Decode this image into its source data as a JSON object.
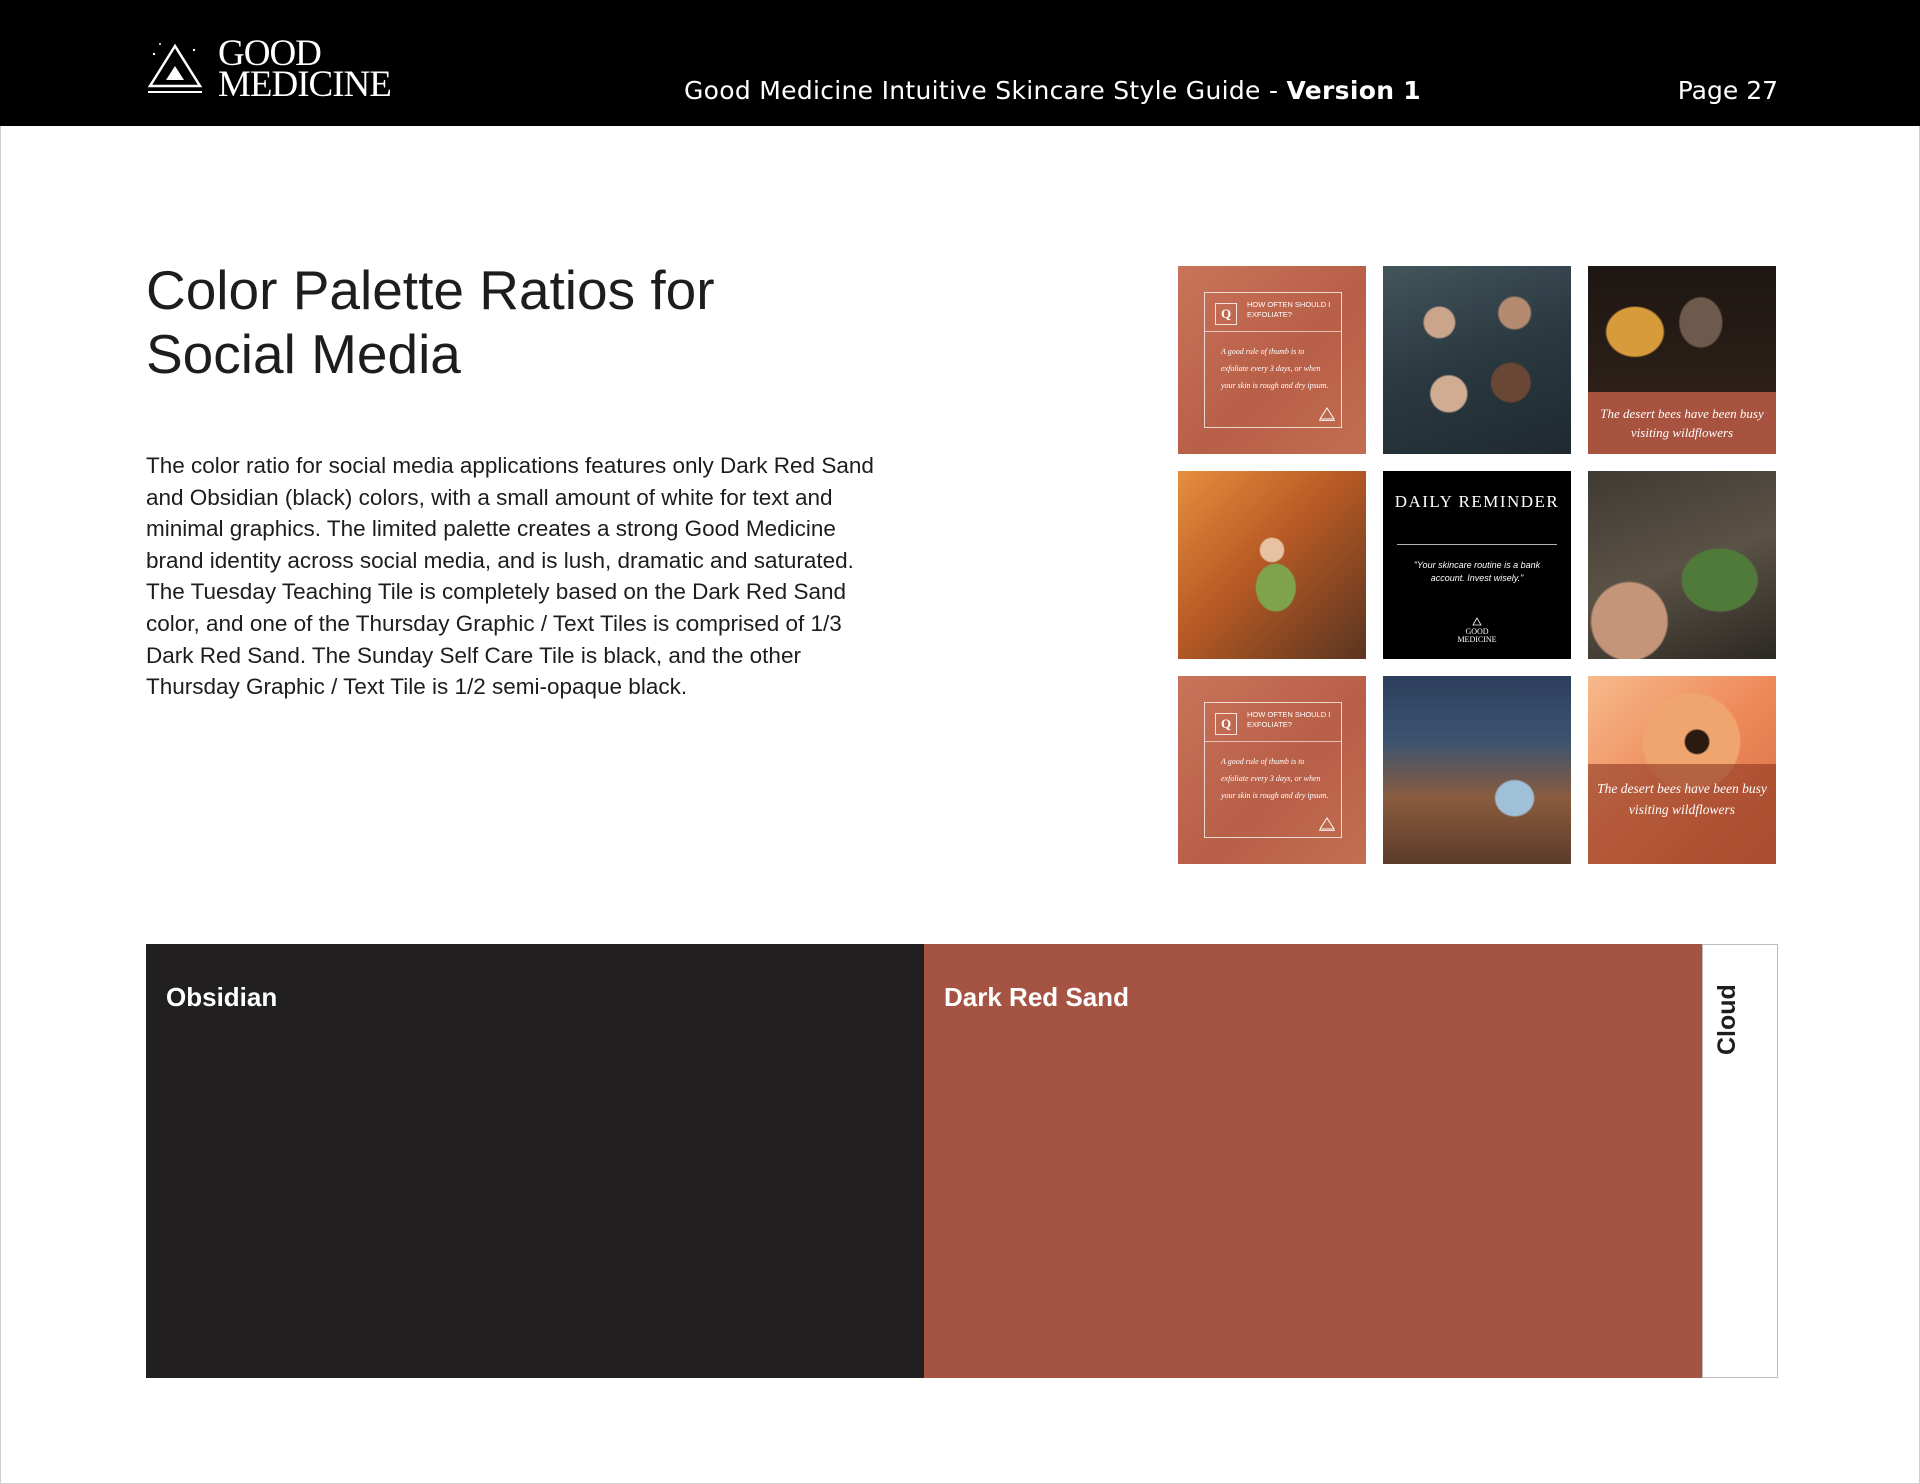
{
  "header": {
    "logo_line1": "GOOD",
    "logo_line2": "MEDICINE",
    "doc_title": "Good Medicine Intuitive Skincare Style Guide - ",
    "doc_version": "Version 1",
    "page_label": "Page 27"
  },
  "main": {
    "heading": "Color Palette Ratios for Social Media",
    "body": "The color ratio for social media applications features only Dark Red Sand and Obsidian (black) colors, with a small amount of white for text and minimal graphics. The limited palette creates a strong Good Medicine brand identity across social media, and is lush, dramatic and saturated. The Tuesday Teaching Tile is completely based on the Dark Red Sand color, and one of the Thursday Graphic / Text Tiles is comprised of 1/3 Dark Red Sand. The Sunday Self Care Tile is black, and the other Thursday Graphic / Text Tile is 1/2 semi-opaque black."
  },
  "tiles": {
    "teaching_q": "Q",
    "teaching_question": "HOW OFTEN SHOULD I EXFOLIATE?",
    "teaching_answer": "A good rule of thumb is to exfoliate every 3 days, or when your skin is rough and dry ipsum.",
    "bees_caption": "The desert bees have been busy visiting wildflowers",
    "reminder_title": "DAILY REMINDER",
    "reminder_quote": "\"Your skincare routine is a bank account. Invest wisely.\"",
    "reminder_logo1": "GOOD",
    "reminder_logo2": "MEDICINE"
  },
  "swatches": [
    {
      "name": "Obsidian",
      "color": "#211f20",
      "ratio": 0.477
    },
    {
      "name": "Dark Red Sand",
      "color": "#a55443",
      "ratio": 0.477
    },
    {
      "name": "Cloud",
      "color": "#ffffff",
      "ratio": 0.046
    }
  ]
}
